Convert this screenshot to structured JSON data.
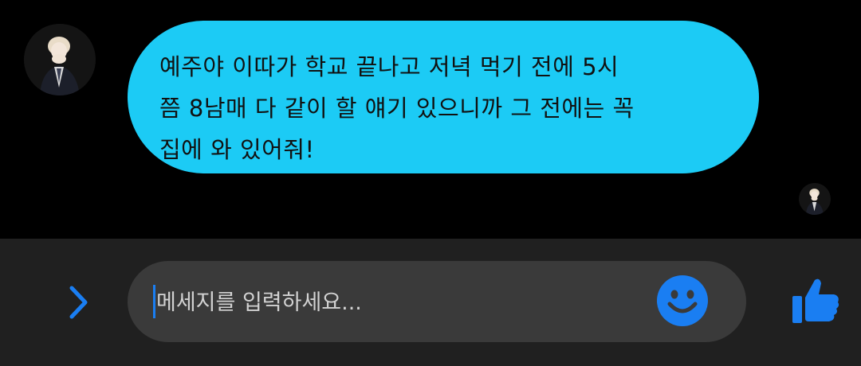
{
  "conversation": {
    "message": {
      "lines": [
        "예주야 이따가 학교 끝나고 저녁 먹기 전에 5시",
        "쯤 8남매 다 같이 할 얘기 있으니까 그 전에는 꼭",
        "집에 와 있어줘!"
      ],
      "bubble_color": "#1ccbf5"
    },
    "sender_avatar_icon": "avatar-photo",
    "seen_avatar_icon": "avatar-photo-small"
  },
  "composer": {
    "input_placeholder": "메세지를 입력하세요...",
    "input_value": "",
    "expand_icon": "chevron-right-icon",
    "emoji_icon": "smiley-icon",
    "like_icon": "thumbs-up-icon",
    "accent_color": "#1a7ef2"
  }
}
